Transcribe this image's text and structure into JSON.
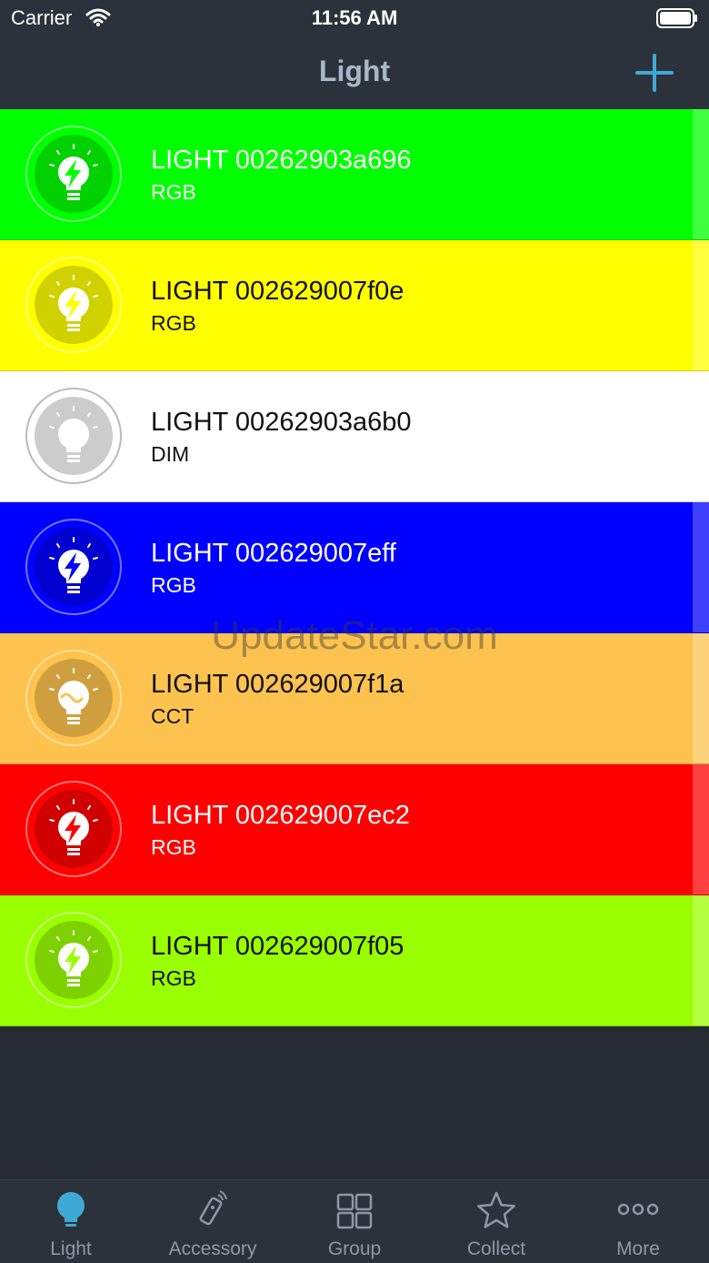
{
  "status": {
    "carrier": "Carrier",
    "time": "11:56 AM"
  },
  "nav": {
    "title": "Light"
  },
  "lights": [
    {
      "name": "LIGHT 00262903a696",
      "type": "RGB",
      "bg": "#00ff00",
      "text": "#ffffff",
      "glyph": "bolt"
    },
    {
      "name": "LIGHT 002629007f0e",
      "type": "RGB",
      "bg": "#ffff00",
      "text": "#111111",
      "glyph": "bolt"
    },
    {
      "name": "LIGHT 00262903a6b0",
      "type": "DIM",
      "bg": "#ffffff",
      "text": "#111111",
      "glyph": "plain"
    },
    {
      "name": "LIGHT 002629007eff",
      "type": "RGB",
      "bg": "#0000ff",
      "text": "#ffffff",
      "glyph": "bolt"
    },
    {
      "name": "LIGHT 002629007f1a",
      "type": "CCT",
      "bg": "#fdc34e",
      "text": "#111111",
      "glyph": "wave"
    },
    {
      "name": "LIGHT 002629007ec2",
      "type": "RGB",
      "bg": "#ff0000",
      "text": "#ffffff",
      "glyph": "bolt"
    },
    {
      "name": "LIGHT 002629007f05",
      "type": "RGB",
      "bg": "#99ff00",
      "text": "#111111",
      "glyph": "bolt"
    }
  ],
  "tabs": [
    {
      "label": "Light",
      "icon": "bulb-icon",
      "active": true
    },
    {
      "label": "Accessory",
      "icon": "remote-icon",
      "active": false
    },
    {
      "label": "Group",
      "icon": "grid-icon",
      "active": false
    },
    {
      "label": "Collect",
      "icon": "star-icon",
      "active": false
    },
    {
      "label": "More",
      "icon": "more-dots-icon",
      "active": false
    }
  ],
  "watermark": "UpdateStar.com",
  "colors": {
    "accent": "#3fa9d6",
    "background": "#262b33",
    "bar": "#2c323b"
  }
}
